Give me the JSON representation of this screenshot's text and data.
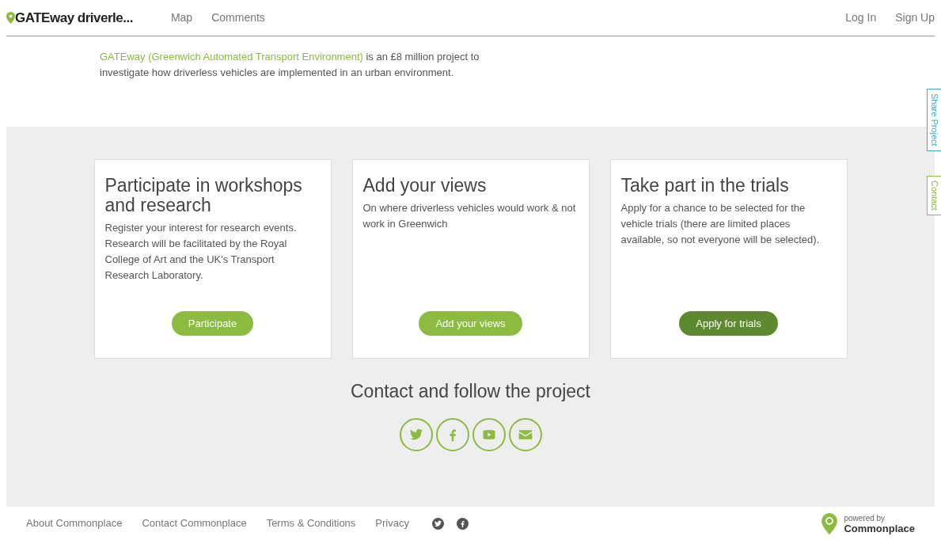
{
  "navbar": {
    "brand": "GATEway driverle...",
    "links": [
      "Map",
      "Comments"
    ],
    "account_links": [
      "Log In",
      "Sign Up"
    ]
  },
  "intro": {
    "link": "GATEway (Greenwich Automated Transport Environment)",
    "text": " is an £8 million project to investigate how driverless vehicles are implemented in an urban environment."
  },
  "side_tabs": [
    {
      "label": "Share Project",
      "color": "#3fa7d6"
    },
    {
      "label": "Contact",
      "color": "#8bbb3f"
    }
  ],
  "cards": [
    {
      "title": "Participate in workshops and research",
      "text": "Register your interest for research events. Research will be facilitated by the Royal College of Art and the UK's Transport Research Laboratory.",
      "button": "Participate",
      "active": false
    },
    {
      "title": "Add your views",
      "text": "On where driverless vehicles would work & not work in Greenwich",
      "button": "Add your views",
      "active": false
    },
    {
      "title": "Take part in the trials",
      "text": "Apply for a chance to be selected for the vehicle trials (there are limited places available, so not everyone will be selected).",
      "button": "Apply for trials",
      "active": true
    }
  ],
  "contact": {
    "heading": "Contact and follow the project",
    "social": [
      {
        "kind": "twitter"
      },
      {
        "kind": "facebook"
      },
      {
        "kind": "youtube"
      },
      {
        "kind": "email"
      }
    ]
  },
  "footer": {
    "links": [
      "About Commonplace",
      "Contact Commonplace",
      "Terms & Conditions",
      "Privacy"
    ],
    "social": [
      {
        "kind": "twitter"
      },
      {
        "kind": "facebook"
      }
    ],
    "powered_by": "powered by",
    "powered_name": "Commonplace"
  }
}
